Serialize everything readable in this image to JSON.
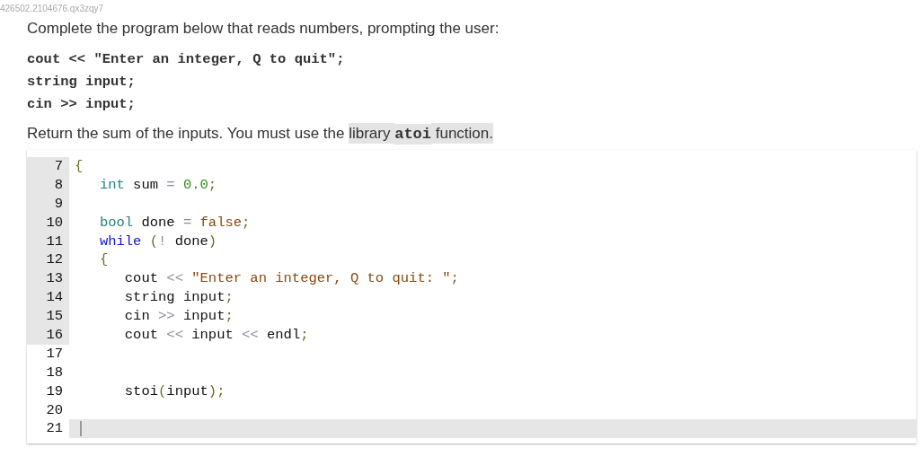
{
  "question_id": "426502.2104676.qx3zqy7",
  "prompt": "Complete the program below that reads numbers, prompting the user:",
  "sample_code": [
    "cout << \"Enter an integer, Q to quit\";",
    "string input;",
    "cin >> input;"
  ],
  "instruction": [
    {
      "text": "Return the sum of the inputs. You must use the ",
      "kind": "text",
      "highlighted": false
    },
    {
      "text": "library ",
      "kind": "text",
      "highlighted": true
    },
    {
      "text": "atoi",
      "kind": "code",
      "highlighted": true
    },
    {
      "text": " function.",
      "kind": "text",
      "highlighted": true
    }
  ],
  "editor": {
    "lines": [
      {
        "number": "7",
        "marked": true,
        "current": false,
        "tokens": [
          {
            "text": "{",
            "kind": "punct"
          }
        ]
      },
      {
        "number": "8",
        "marked": true,
        "current": false,
        "tokens": [
          {
            "text": "   int",
            "kind": "type"
          },
          {
            "text": " sum ",
            "kind": "plain"
          },
          {
            "text": "=",
            "kind": "op"
          },
          {
            "text": " 0.0",
            "kind": "number"
          },
          {
            "text": ";",
            "kind": "punct"
          }
        ]
      },
      {
        "number": "9",
        "marked": true,
        "current": false
      },
      {
        "number": "10",
        "marked": true,
        "current": false,
        "tokens": [
          {
            "text": "   bool",
            "kind": "type"
          },
          {
            "text": " done ",
            "kind": "plain"
          },
          {
            "text": "=",
            "kind": "op"
          },
          {
            "text": " false",
            "kind": "string"
          },
          {
            "text": ";",
            "kind": "punct"
          }
        ]
      },
      {
        "number": "11",
        "marked": true,
        "current": false,
        "tokens": [
          {
            "text": "   while",
            "kind": "keyword"
          },
          {
            "text": " (",
            "kind": "punct"
          },
          {
            "text": "!",
            "kind": "op"
          },
          {
            "text": " done",
            "kind": "plain"
          },
          {
            "text": ")",
            "kind": "punct"
          }
        ]
      },
      {
        "number": "12",
        "marked": true,
        "current": false,
        "tokens": [
          {
            "text": "   {",
            "kind": "punct"
          }
        ]
      },
      {
        "number": "13",
        "marked": true,
        "current": false,
        "tokens": [
          {
            "text": "      cout ",
            "kind": "plain"
          },
          {
            "text": "<<",
            "kind": "op"
          },
          {
            "text": " \"Enter an integer, Q to quit: \"",
            "kind": "string"
          },
          {
            "text": ";",
            "kind": "punct"
          }
        ]
      },
      {
        "number": "14",
        "marked": true,
        "current": false,
        "tokens": [
          {
            "text": "      string input",
            "kind": "plain"
          },
          {
            "text": ";",
            "kind": "punct"
          }
        ]
      },
      {
        "number": "15",
        "marked": true,
        "current": false,
        "tokens": [
          {
            "text": "      cin ",
            "kind": "plain"
          },
          {
            "text": ">>",
            "kind": "op"
          },
          {
            "text": " input",
            "kind": "plain"
          },
          {
            "text": ";",
            "kind": "punct"
          }
        ]
      },
      {
        "number": "16",
        "marked": true,
        "current": false,
        "tokens": [
          {
            "text": "      cout ",
            "kind": "plain"
          },
          {
            "text": "<<",
            "kind": "op"
          },
          {
            "text": " input ",
            "kind": "plain"
          },
          {
            "text": "<<",
            "kind": "op"
          },
          {
            "text": " endl",
            "kind": "plain"
          },
          {
            "text": ";",
            "kind": "punct"
          }
        ]
      },
      {
        "number": "17",
        "marked": false,
        "current": false
      },
      {
        "number": "18",
        "marked": false,
        "current": false
      },
      {
        "number": "19",
        "marked": false,
        "current": false,
        "tokens": [
          {
            "text": "      stoi",
            "kind": "plain"
          },
          {
            "text": "(",
            "kind": "punct"
          },
          {
            "text": "input",
            "kind": "plain"
          },
          {
            "text": ")",
            "kind": "punct"
          },
          {
            "text": ";",
            "kind": "punct"
          }
        ]
      },
      {
        "number": "20",
        "marked": false,
        "current": false
      },
      {
        "number": "21",
        "marked": false,
        "current": true
      }
    ]
  }
}
